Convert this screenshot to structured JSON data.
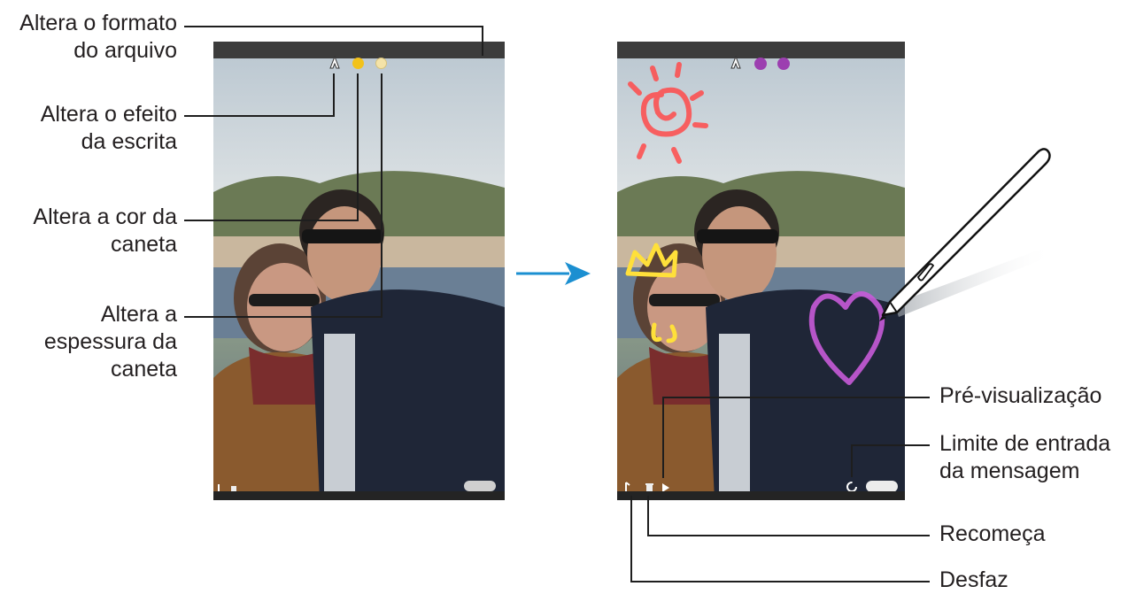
{
  "left_labels": {
    "file_format": "Altera o formato\ndo arquivo",
    "writing_effect": "Altera o efeito\nda escrita",
    "pen_color": "Altera a cor da\ncaneta",
    "pen_thickness": "Altera a\nespessura da\ncaneta"
  },
  "right_labels": {
    "preview": "Pré-visualização",
    "input_limit": "Limite de entrada\nda mensagem",
    "restart": "Recomeça",
    "undo": "Desfaz"
  },
  "colors": {
    "callout_line": "#1e1e1e",
    "arrow": "#1b8fd1",
    "pen_yellow": "#f2c21b",
    "pen_purple": "#9c3fb0"
  },
  "icons": [
    "pen-effect-icon",
    "color-swatch-icon",
    "thickness-icon",
    "play-icon",
    "timer-icon",
    "undo-icon",
    "trash-icon"
  ]
}
